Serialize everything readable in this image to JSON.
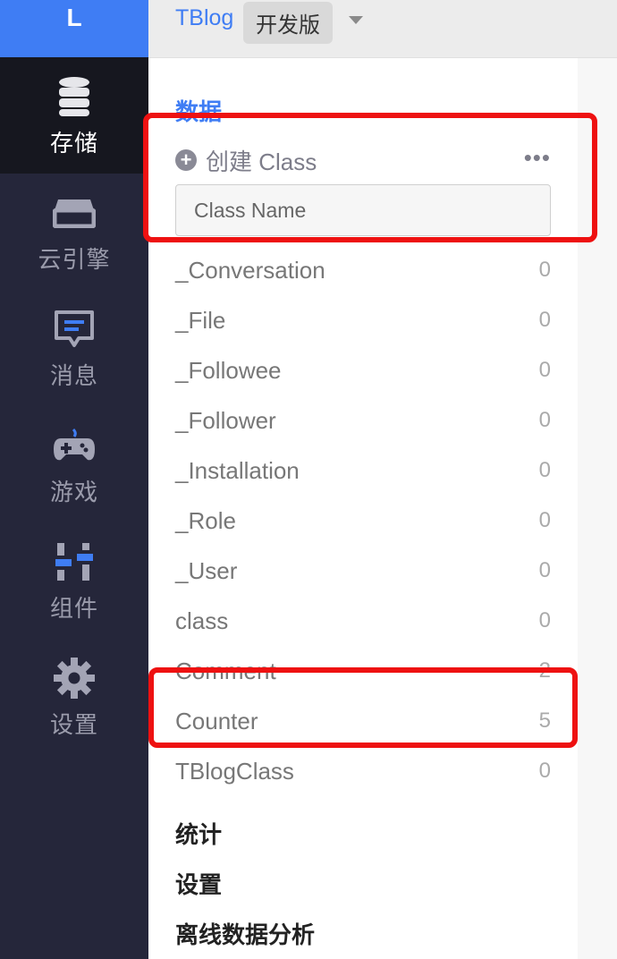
{
  "logo": {
    "letter": "L"
  },
  "nav": {
    "items": [
      {
        "label": "存储"
      },
      {
        "label": "云引擎"
      },
      {
        "label": "消息"
      },
      {
        "label": "游戏"
      },
      {
        "label": "组件"
      },
      {
        "label": "设置"
      }
    ]
  },
  "topbar": {
    "app_name": "TBlog",
    "env_badge": "开发版"
  },
  "panel": {
    "section_data": "数据",
    "create_class": "创建 Class",
    "more": "•••",
    "input_placeholder": "Class Name",
    "classes": [
      {
        "name": "_Conversation",
        "count": "0"
      },
      {
        "name": "_File",
        "count": "0"
      },
      {
        "name": "_Followee",
        "count": "0"
      },
      {
        "name": "_Follower",
        "count": "0"
      },
      {
        "name": "_Installation",
        "count": "0"
      },
      {
        "name": "_Role",
        "count": "0"
      },
      {
        "name": "_User",
        "count": "0"
      },
      {
        "name": "class",
        "count": "0"
      },
      {
        "name": "Comment",
        "count": "2"
      },
      {
        "name": "Counter",
        "count": "5"
      },
      {
        "name": "TBlogClass",
        "count": "0"
      }
    ],
    "bottom_links": [
      "统计",
      "设置",
      "离线数据分析"
    ]
  },
  "colors": {
    "accent": "#3f7df4",
    "sidebar_bg": "#25263a",
    "highlight": "#ee1111"
  }
}
